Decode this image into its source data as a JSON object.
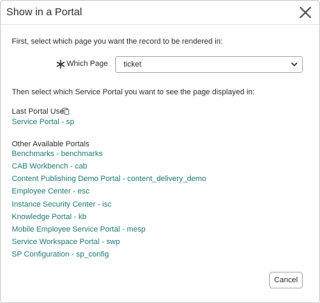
{
  "modal": {
    "title": "Show in a Portal",
    "close_icon": "close-icon"
  },
  "instructions": {
    "first": "First, select which page you want the record to be rendered in:",
    "then": "Then select which Service Portal you want to see the page displayed in:"
  },
  "page_field": {
    "required_marker": "∗",
    "label": "Which Page",
    "selected_value": "ticket"
  },
  "last_portal": {
    "label": "Last Portal Used",
    "icon": "copy-icon",
    "link": "Service Portal - sp"
  },
  "other_portals": {
    "label": "Other Available Portals",
    "links": [
      "Benchmarks - benchmarks",
      "CAB Workbench - cab",
      "Content Publishing Demo Portal - content_delivery_demo",
      "Employee Center - esc",
      "Instance Security Center - isc",
      "Knowledge Portal - kb",
      "Mobile Employee Service Portal - mesp",
      "Service Workspace Portal - swp",
      "SP Configuration - sp_config"
    ]
  },
  "footer": {
    "cancel_label": "Cancel"
  },
  "colors": {
    "link": "#1f7a74",
    "text": "#2e2e2e",
    "border": "#c9c9c9"
  }
}
